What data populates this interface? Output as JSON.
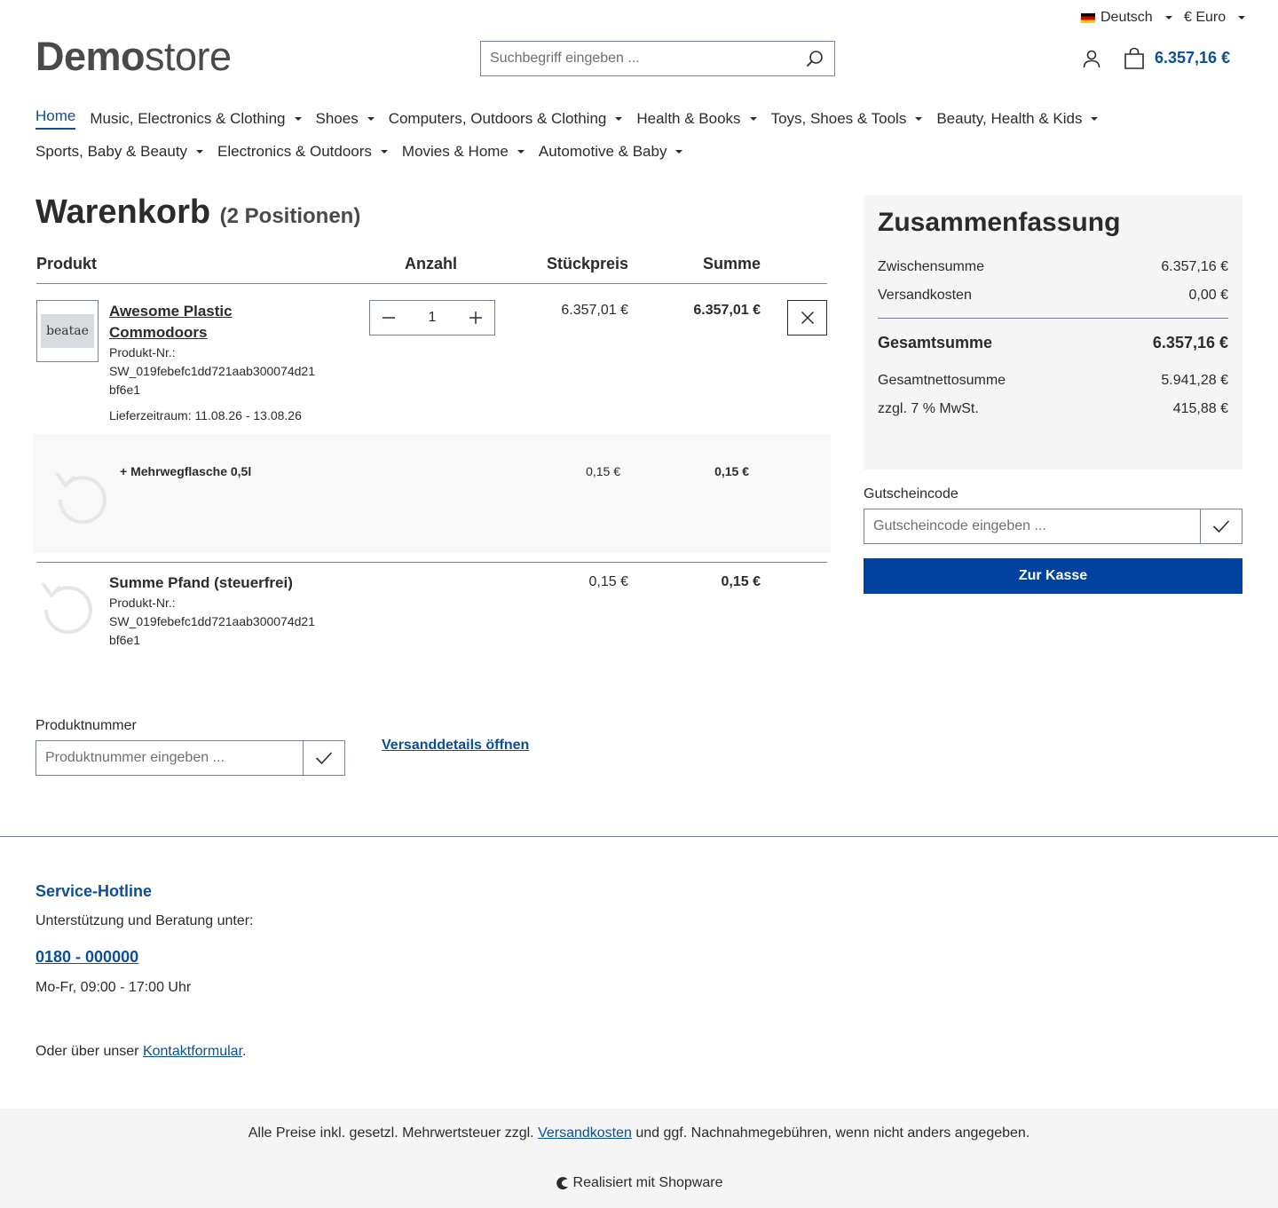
{
  "topbar": {
    "language": "Deutsch",
    "currency": "€ Euro"
  },
  "logo": {
    "bold": "Demo",
    "light": "store"
  },
  "search": {
    "placeholder": "Suchbegriff eingeben ..."
  },
  "header": {
    "cart_total": "6.357,16 €"
  },
  "nav": {
    "row1": [
      {
        "label": "Home",
        "active": true,
        "dropdown": false
      },
      {
        "label": "Music, Electronics & Clothing",
        "dropdown": true
      },
      {
        "label": "Shoes",
        "dropdown": true
      },
      {
        "label": "Computers, Outdoors & Clothing",
        "dropdown": true
      },
      {
        "label": "Health & Books",
        "dropdown": true
      },
      {
        "label": "Toys, Shoes & Tools",
        "dropdown": true
      },
      {
        "label": "Beauty, Health & Kids",
        "dropdown": true
      }
    ],
    "row2": [
      {
        "label": "Sports, Baby & Beauty",
        "dropdown": true
      },
      {
        "label": "Electronics & Outdoors",
        "dropdown": true
      },
      {
        "label": "Movies & Home",
        "dropdown": true
      },
      {
        "label": "Automotive & Baby",
        "dropdown": true
      }
    ]
  },
  "cart": {
    "title": "Warenkorb",
    "count_label": "(2 Positionen)",
    "columns": {
      "product": "Produkt",
      "quantity": "Anzahl",
      "unit_price": "Stückpreis",
      "total": "Summe"
    },
    "item": {
      "thumb_text": "beatae",
      "name_line1": "Awesome Plastic",
      "name_line2": "Commodoors",
      "number_label": "Produkt-Nr.:",
      "number_line1": "SW_019febefc1dd721aab300074d21",
      "number_line2": "bf6e1",
      "delivery": "Lieferzeitraum: 11.08.26 - 13.08.26",
      "quantity": "1",
      "unit_price": "6.357,01 €",
      "total": "6.357,01 €"
    },
    "deposit": {
      "label": "+ Mehrwegflasche 0,5l",
      "unit_price": "0,15 €",
      "total": "0,15 €"
    },
    "deposit_sum": {
      "name": "Summe Pfand (steuerfrei)",
      "number_label": "Produkt-Nr.:",
      "number_line1": "SW_019febefc1dd721aab300074d21",
      "number_line2": "bf6e1",
      "unit_price": "0,15 €",
      "total": "0,15 €"
    }
  },
  "product_number": {
    "label": "Produktnummer",
    "placeholder": "Produktnummer eingeben ..."
  },
  "shipping_link": "Versanddetails öffnen",
  "summary": {
    "title": "Zusammenfassung",
    "subtotal_label": "Zwischensumme",
    "subtotal": "6.357,16 €",
    "shipping_label": "Versandkosten",
    "shipping": "0,00 €",
    "total_label": "Gesamtsumme",
    "total": "6.357,16 €",
    "net_label": "Gesamtnettosumme",
    "net": "5.941,28 €",
    "tax_label": "zzgl. 7 % MwSt.",
    "tax": "415,88 €"
  },
  "voucher": {
    "label": "Gutscheincode",
    "placeholder": "Gutscheincode eingeben ..."
  },
  "checkout_label": "Zur Kasse",
  "footer": {
    "hotline_title": "Service-Hotline",
    "support_text": "Unterstützung und Beratung unter:",
    "phone": "0180 - 000000",
    "hours": "Mo-Fr, 09:00 - 17:00 Uhr",
    "contact_prefix": "Oder über unser ",
    "contact_link": "Kontaktformular",
    "contact_suffix": ".",
    "vat_prefix": "Alle Preise inkl. gesetzl. Mehrwertsteuer zzgl. ",
    "vat_link": "Versandkosten",
    "vat_suffix": " und ggf. Nachnahmegebühren, wenn nicht anders angegeben.",
    "powered": "Realisiert mit Shopware"
  },
  "colors": {
    "brand_blue": "#0b4f95",
    "button_blue": "#0042a0"
  }
}
